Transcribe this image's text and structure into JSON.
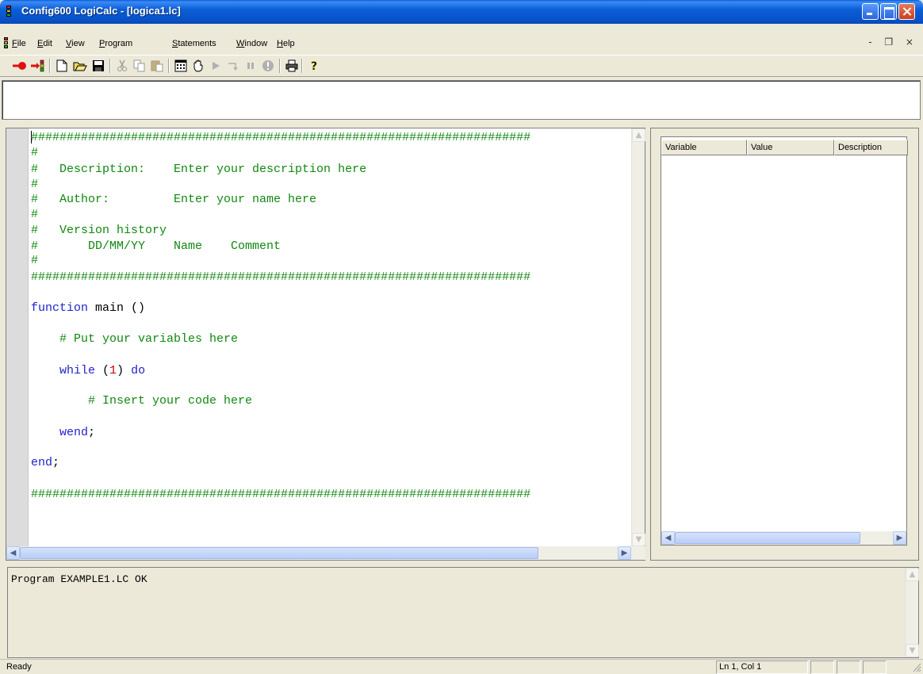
{
  "window": {
    "title": "Config600 LogiCalc - [logica1.lc]",
    "mdi_controls": "- ❐ ×"
  },
  "menu": {
    "items": [
      "File",
      "Edit",
      "View",
      "Program",
      "Statements",
      "Window",
      "Help"
    ]
  },
  "toolbar": {
    "buttons": [
      "connect-icon",
      "disconnect-icon",
      "new-file-icon",
      "open-folder-icon",
      "save-icon",
      "cut-icon",
      "copy-icon",
      "paste-icon",
      "compile-icon",
      "stop-hand-icon",
      "run-icon",
      "step-icon",
      "pause-icon",
      "info-icon",
      "print-icon",
      "help-icon"
    ]
  },
  "expression_box": {
    "value": ""
  },
  "editor": {
    "lines": [
      "######################################################################",
      "#",
      "#   Description:    Enter your description here",
      "#",
      "#   Author:         Enter your name here",
      "#",
      "#   Version history",
      "#       DD/MM/YY    Name    Comment",
      "#",
      "######################################################################",
      "",
      "function main ()",
      "",
      "    # Put your variables here",
      "",
      "    while (1) do",
      "",
      "        # Insert your code here",
      "",
      "    wend;",
      "",
      "end;",
      "",
      "######################################################################"
    ],
    "tokens": {
      "function_kw": "function",
      "main_sig": " main ()",
      "comment_vars": "# Put your variables here",
      "while_kw": "while",
      "paren_open": " (",
      "one": "1",
      "paren_close": ") ",
      "do_kw": "do",
      "comment_code": "# Insert your code here",
      "wend_kw": "wend",
      "semicolon": ";",
      "end_kw": "end"
    },
    "colors": {
      "comment": "#118811",
      "keyword": "#2222cc",
      "number": "#cc0000"
    }
  },
  "variables_panel": {
    "columns": [
      "Variable",
      "Value",
      "Description"
    ]
  },
  "output": {
    "text": "Program EXAMPLE1.LC OK"
  },
  "statusbar": {
    "status": "Ready",
    "position": "Ln 1, Col 1"
  }
}
